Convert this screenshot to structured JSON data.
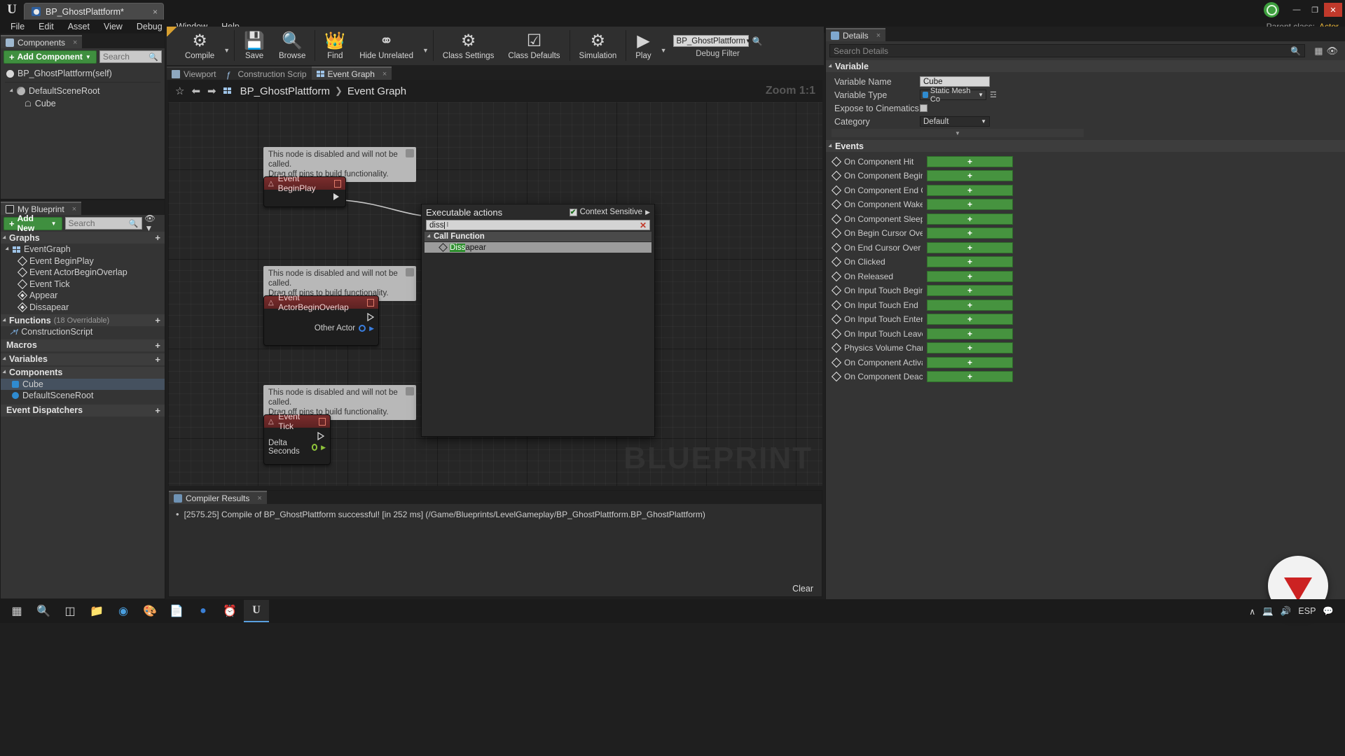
{
  "titlebar": {
    "logo": "unreal-logo",
    "tab_label": "BP_GhostPlattform*",
    "close_label": "×",
    "minimize": "—",
    "maximize": "❐",
    "window_close": "✕"
  },
  "menubar": {
    "items": [
      "File",
      "Edit",
      "Asset",
      "View",
      "Debug",
      "Window",
      "Help"
    ],
    "parent_class_label": "Parent class:",
    "parent_class_value": "Actor"
  },
  "toolbar": {
    "items": [
      {
        "label": "Compile",
        "icon": "compile-icon",
        "has_caret": true
      },
      {
        "label": "Save",
        "icon": "save-icon",
        "has_caret": false
      },
      {
        "label": "Browse",
        "icon": "browse-icon",
        "has_caret": false
      },
      {
        "label": "Find",
        "icon": "find-icon",
        "has_caret": false
      },
      {
        "label": "Hide Unrelated",
        "icon": "hide-unrelated-icon",
        "has_caret": true
      },
      {
        "label": "Class Settings",
        "icon": "class-settings-icon",
        "has_caret": false
      },
      {
        "label": "Class Defaults",
        "icon": "class-defaults-icon",
        "has_caret": false
      },
      {
        "label": "Simulation",
        "icon": "simulation-icon",
        "has_caret": false
      },
      {
        "label": "Play",
        "icon": "play-icon",
        "has_caret": true
      }
    ],
    "debug_filter_value": "BP_GhostPlattform",
    "debug_filter_label": "Debug Filter",
    "search_icon": "search-icon"
  },
  "components_panel": {
    "tab_label": "Components",
    "tab_close": "×",
    "add_button": "Add Component",
    "add_plus": "+",
    "search_placeholder": "Search",
    "tree": [
      {
        "label": "BP_GhostPlattform(self)",
        "icon": "self-actor-icon",
        "indent": 0
      },
      {
        "label": "DefaultSceneRoot",
        "icon": "scene-root-icon",
        "indent": 1
      },
      {
        "label": "Cube",
        "icon": "static-mesh-icon",
        "indent": 2
      }
    ]
  },
  "myblueprint_panel": {
    "tab_label": "My Blueprint",
    "tab_close": "×",
    "add_button": "Add New",
    "add_plus": "+",
    "search_placeholder": "Search",
    "eye_icon": "visibility-icon",
    "sections": [
      {
        "title": "Graphs",
        "count": "",
        "plus": "+",
        "rows": [
          {
            "label": "EventGraph",
            "icon": "graph-icon",
            "indent": 0
          },
          {
            "label": "Event BeginPlay",
            "icon": "event-icon",
            "indent": 1
          },
          {
            "label": "Event ActorBeginOverlap",
            "icon": "event-icon",
            "indent": 1
          },
          {
            "label": "Event Tick",
            "icon": "event-icon",
            "indent": 1
          },
          {
            "label": "Appear",
            "icon": "custom-event-icon",
            "indent": 1
          },
          {
            "label": "Dissapear",
            "icon": "custom-event-icon",
            "indent": 1
          }
        ]
      },
      {
        "title": "Functions",
        "count": "(18 Overridable)",
        "plus": "+",
        "rows": [
          {
            "label": "ConstructionScript",
            "icon": "function-icon",
            "indent": 0
          }
        ]
      },
      {
        "title": "Macros",
        "count": "",
        "plus": "+",
        "rows": []
      },
      {
        "title": "Variables",
        "count": "",
        "plus": "+",
        "rows": []
      },
      {
        "title": "Components",
        "count": "",
        "plus": "",
        "rows": [
          {
            "label": "Cube",
            "icon": "static-mesh-var-icon",
            "indent": 0
          },
          {
            "label": "DefaultSceneRoot",
            "icon": "scene-var-icon",
            "indent": 0
          }
        ]
      },
      {
        "title": "Event Dispatchers",
        "count": "",
        "plus": "+",
        "rows": []
      }
    ]
  },
  "graph_tabs": [
    {
      "label": "Viewport",
      "icon": "viewport-icon",
      "active": false
    },
    {
      "label": "Construction Scrip",
      "icon": "construction-icon",
      "active": false
    },
    {
      "label": "Event Graph",
      "icon": "event-graph-icon",
      "active": true,
      "close": "×"
    }
  ],
  "graph": {
    "star_icon": "bookmark-icon",
    "back_icon": "⬅",
    "forward_icon": "➡",
    "grid_icon": "graph-list-icon",
    "breadcrumb_root": "BP_GhostPlattform",
    "breadcrumb_sep": "❯",
    "breadcrumb_current": "Event Graph",
    "zoom_label": "Zoom 1:1",
    "watermark": "BLUEPRINT",
    "disabled_note_line1": "This node is disabled and will not be called.",
    "disabled_note_line2": "Drag off pins to build functionality.",
    "nodes": [
      {
        "title": "Event BeginPlay",
        "pins": [],
        "note": true
      },
      {
        "title": "Event ActorBeginOverlap",
        "pins": [
          "Other Actor"
        ],
        "note": true
      },
      {
        "title": "Event Tick",
        "pins": [
          "Delta Seconds"
        ],
        "note": true
      }
    ]
  },
  "action_menu": {
    "title": "Executable actions",
    "context_sensitive_label": "Context Sensitive",
    "context_sensitive_checked": true,
    "check_glyph": "✔",
    "arrow_glyph": "▶",
    "search_value": "diss",
    "clear_glyph": "✕",
    "category": "Call Function",
    "results": [
      {
        "highlight": "Diss",
        "rest": "apear"
      }
    ]
  },
  "compiler_results": {
    "tab_label": "Compiler Results",
    "tab_close": "×",
    "bullet": "•",
    "message": "[2575.25] Compile of BP_GhostPlattform successful! [in 252 ms] (/Game/Blueprints/LevelGameplay/BP_GhostPlattform.BP_GhostPlattform)",
    "clear_label": "Clear"
  },
  "details_panel": {
    "tab_label": "Details",
    "tab_close": "×",
    "search_placeholder": "Search Details",
    "search_icon": "search-icon",
    "grid_icon": "grid-view-icon",
    "eye_icon": "visibility-icon",
    "variable_section": "Variable",
    "rows": [
      {
        "label": "Variable Name",
        "type": "text",
        "value": "Cube"
      },
      {
        "label": "Variable Type",
        "type": "combo",
        "value": "Static Mesh Co"
      },
      {
        "label": "Expose to Cinematics",
        "type": "check",
        "value": ""
      },
      {
        "label": "Category",
        "type": "category",
        "value": "Default"
      }
    ],
    "expander_glyph": "▼",
    "events_section": "Events",
    "event_plus": "+",
    "events": [
      "On Component Hit",
      "On Component Begin Ov",
      "On Component End Over",
      "On Component Wake",
      "On Component Sleep",
      "On Begin Cursor Over",
      "On End Cursor Over",
      "On Clicked",
      "On Released",
      "On Input Touch Begin",
      "On Input Touch End",
      "On Input Touch Enter",
      "On Input Touch Leave",
      "Physics Volume Change",
      "On Component Activate",
      "On Component Deactiva"
    ]
  },
  "taskbar": {
    "items": [
      {
        "icon": "windows-start-icon",
        "active": false
      },
      {
        "icon": "search-icon",
        "active": false
      },
      {
        "icon": "task-view-icon",
        "active": false
      },
      {
        "icon": "file-explorer-icon",
        "active": false
      },
      {
        "icon": "browser-icon",
        "active": false
      },
      {
        "icon": "paint-icon",
        "active": false
      },
      {
        "icon": "notepad-icon",
        "active": false
      },
      {
        "icon": "blue-app-icon",
        "active": false
      },
      {
        "icon": "clock-icon",
        "active": false
      },
      {
        "icon": "unreal-editor-icon",
        "active": true
      }
    ],
    "tray": {
      "chevron": "∧",
      "network_icon": "network-icon",
      "volume_icon": "volume-icon",
      "language": "ESP",
      "notification_icon": "notification-icon"
    }
  },
  "colors": {
    "accent_green": "#46933f",
    "event_node_red": "#7a2d2d",
    "highlight_green": "#2f8f2f",
    "panel_bg": "#343434",
    "graph_bg": "#262626"
  }
}
